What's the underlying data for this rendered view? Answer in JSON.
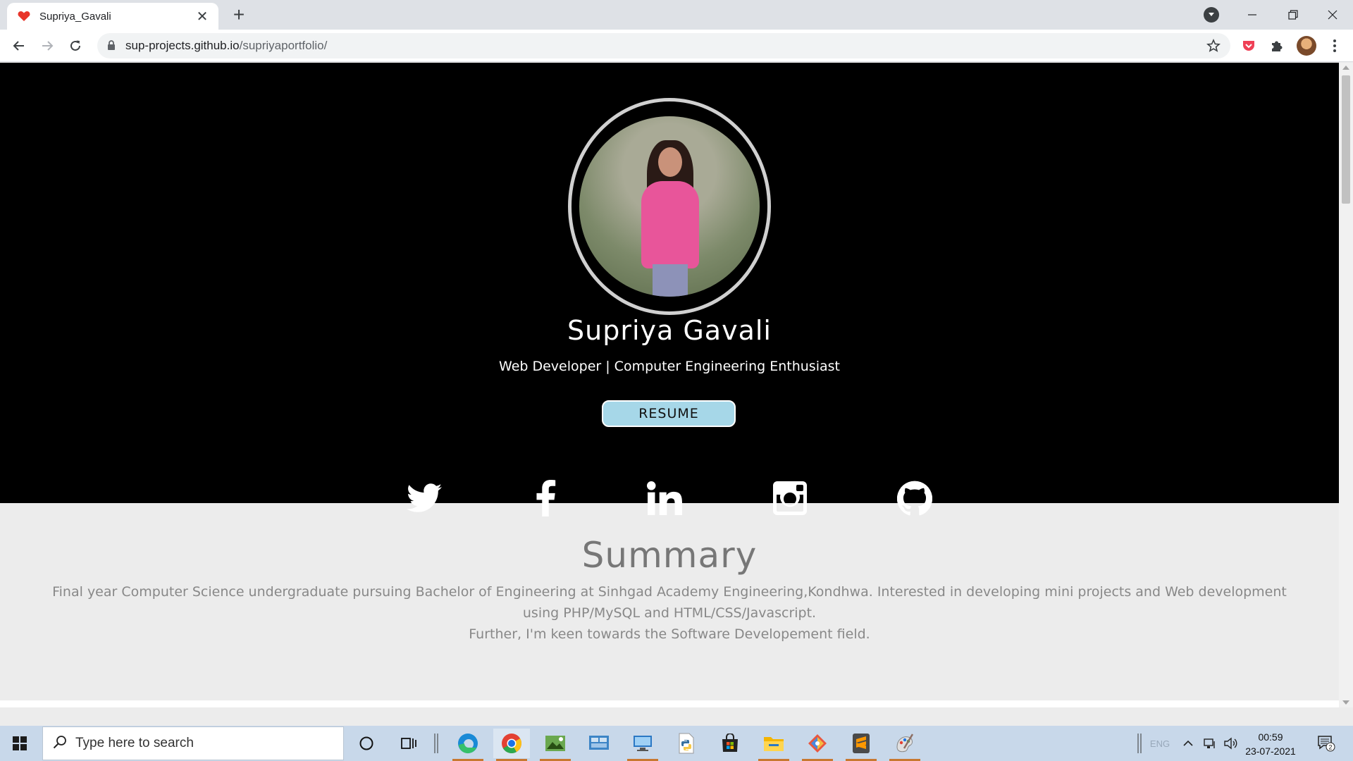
{
  "browser": {
    "tab_title": "Supriya_Gavali",
    "url_host": "sup-projects.github.io",
    "url_path": "/supriyaportfolio/"
  },
  "profile": {
    "name": "Supriya Gavali",
    "tagline": "Web Developer | Computer Engineering Enthusiast",
    "resume_label": "RESUME"
  },
  "social": [
    "twitter-icon",
    "facebook-icon",
    "linkedin-icon",
    "instagram-icon",
    "github-icon"
  ],
  "summary": {
    "title": "Summary",
    "line1": "Final year Computer Science undergraduate pursuing Bachelor of Engineering at Sinhgad Academy Engineering,Kondhwa. Interested in developing mini projects and Web development using PHP/MySQL and HTML/CSS/Javascript.",
    "line2": "Further, I'm keen towards the Software Developement field."
  },
  "taskbar": {
    "search_placeholder": "Type here to search",
    "lang": "ENG",
    "time": "00:59",
    "date": "23-07-2021",
    "notification_count": "2"
  },
  "colors": {
    "hero_bg": "#000000",
    "resume_button_bg": "#a6d7e8",
    "page_bg": "#ececec"
  }
}
